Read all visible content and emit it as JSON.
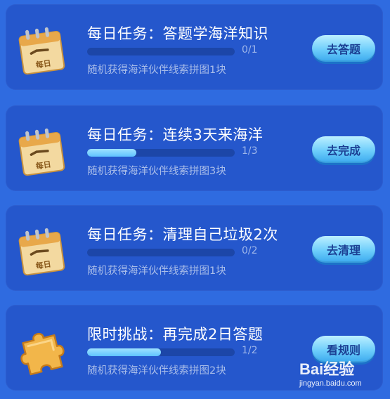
{
  "tasks": [
    {
      "title": "每日任务：答题学海洋知识",
      "progress_text": "0/1",
      "progress_fraction": 0,
      "reward": "随机获得海洋伙伴线索拼图1块",
      "button": "去答题",
      "icon": "daily-calendar-icon",
      "icon_text": "每日"
    },
    {
      "title": "每日任务：连续3天来海洋",
      "progress_text": "1/3",
      "progress_fraction": 0.333,
      "reward": "随机获得海洋伙伴线索拼图3块",
      "button": "去完成",
      "icon": "daily-calendar-icon",
      "icon_text": "每日"
    },
    {
      "title": "每日任务：清理自己垃圾2次",
      "progress_text": "0/2",
      "progress_fraction": 0,
      "reward": "随机获得海洋伙伴线索拼图1块",
      "button": "去清理",
      "icon": "daily-calendar-icon",
      "icon_text": "每日"
    },
    {
      "title": "限时挑战：再完成2日答题",
      "progress_text": "1/2",
      "progress_fraction": 0.5,
      "reward": "随机获得海洋伙伴线索拼图2块",
      "button": "看规则",
      "icon": "puzzle-piece-icon"
    }
  ],
  "watermark": {
    "brand": "Bai经验",
    "url": "jingyan.baidu.com"
  },
  "colors": {
    "background": "#2f6be0",
    "card": "#2557cc",
    "progress_fill": "#5fc3ff",
    "button": "#6dcdfb"
  }
}
